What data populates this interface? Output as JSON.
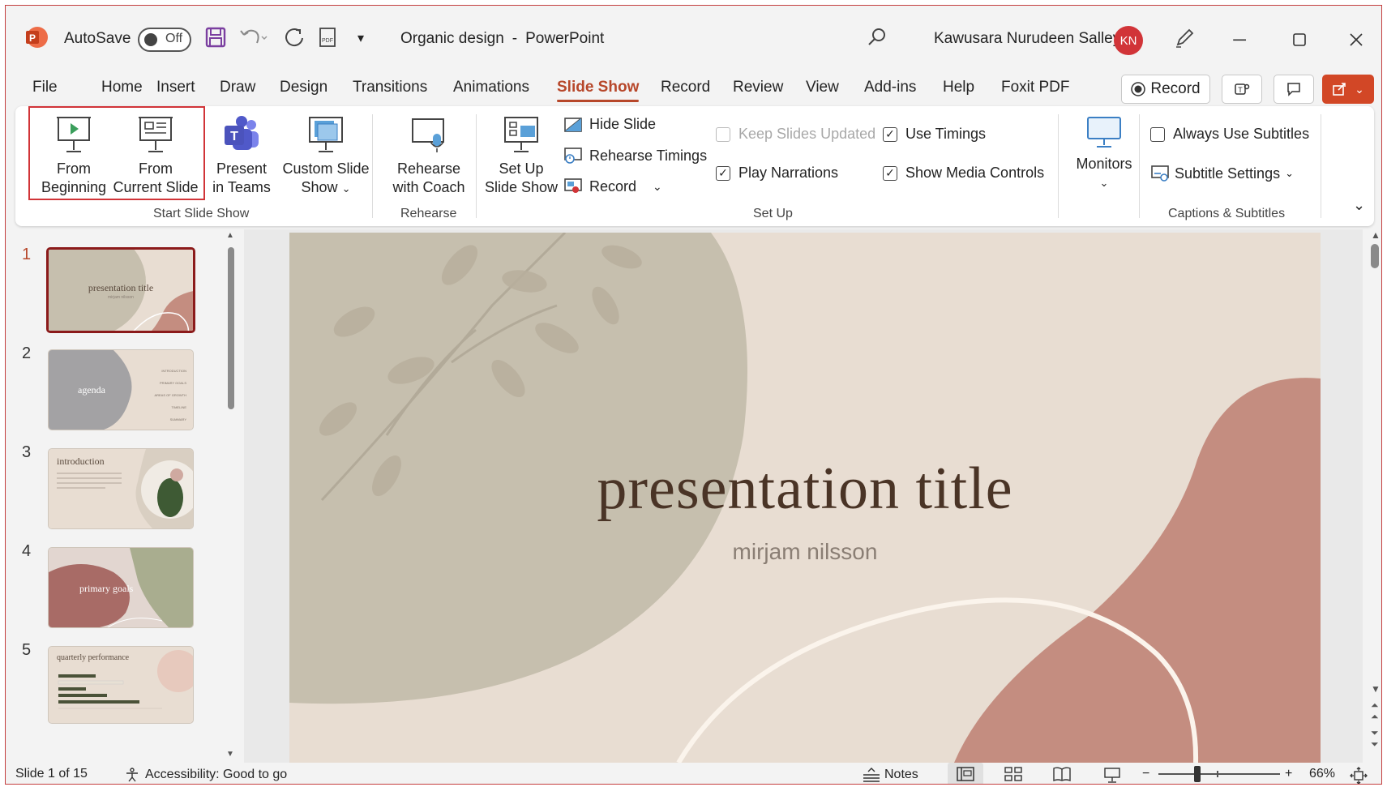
{
  "titlebar": {
    "autosave_label": "AutoSave",
    "autosave_state": "Off",
    "doc_name": "Organic design",
    "separator": "-",
    "app_name": "PowerPoint",
    "user_name": "Kawusara Nurudeen Salley",
    "user_initials": "KN"
  },
  "tabs": [
    "File",
    "Home",
    "Insert",
    "Draw",
    "Design",
    "Transitions",
    "Animations",
    "Slide Show",
    "Record",
    "Review",
    "View",
    "Add-ins",
    "Help",
    "Foxit PDF"
  ],
  "active_tab": "Slide Show",
  "tab_right": {
    "record_label": "Record"
  },
  "ribbon": {
    "start_group": {
      "label": "Start Slide Show",
      "from_beginning": [
        "From",
        "Beginning"
      ],
      "from_current": [
        "From",
        "Current Slide"
      ],
      "present_teams": [
        "Present",
        "in Teams"
      ],
      "custom_show": [
        "Custom Slide",
        "Show"
      ]
    },
    "rehearse_group": {
      "label": "Rehearse",
      "rehearse_coach": [
        "Rehearse",
        "with Coach"
      ]
    },
    "setup_group": {
      "label": "Set Up",
      "setup_show": [
        "Set Up",
        "Slide Show"
      ],
      "hide_slide": "Hide Slide",
      "rehearse_timings": "Rehearse Timings",
      "record": "Record",
      "keep_updated": "Keep Slides Updated",
      "play_narrations": "Play Narrations",
      "use_timings": "Use Timings",
      "show_media_controls": "Show Media Controls"
    },
    "monitors_group": {
      "monitors": "Monitors"
    },
    "captions_group": {
      "label": "Captions & Subtitles",
      "always_subtitles": "Always Use Subtitles",
      "subtitle_settings": "Subtitle Settings"
    }
  },
  "thumbnails": [
    {
      "num": "1",
      "title": "presentation title",
      "sub": "mirjam nilsson"
    },
    {
      "num": "2",
      "title": "agenda",
      "items": [
        "INTRODUCTION",
        "PRIMARY GOALS",
        "AREAS OF GROWTH",
        "TIMELINE",
        "SUMMARY"
      ]
    },
    {
      "num": "3",
      "title": "introduction"
    },
    {
      "num": "4",
      "title": "primary goals"
    },
    {
      "num": "5",
      "title": "quarterly performance"
    }
  ],
  "slide": {
    "title": "presentation title",
    "subtitle": "mirjam nilsson"
  },
  "status": {
    "slide_info": "Slide 1 of 15",
    "accessibility": "Accessibility: Good to go",
    "notes": "Notes",
    "zoom": "66%"
  },
  "colors": {
    "accent": "#b7472a",
    "slide_bg": "#e8ddd2",
    "sage": "#c6bfae",
    "terracotta": "#c48d80"
  }
}
